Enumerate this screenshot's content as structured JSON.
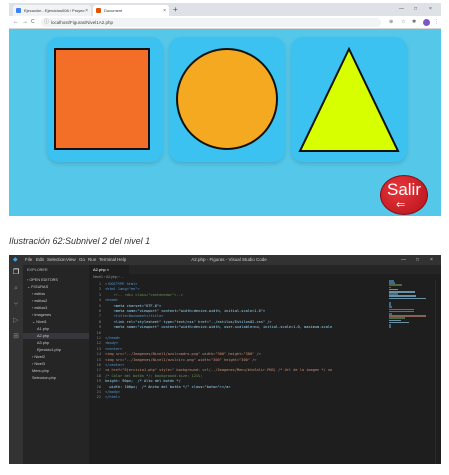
{
  "browser": {
    "tabs": [
      {
        "label": "Ejecución - Ejercicios008 / Proyec",
        "icon": "doc-icon",
        "color": "#3b82f6"
      },
      {
        "label": "Document",
        "icon": "html-icon",
        "color": "#e65100"
      }
    ],
    "new_tab_label": "+",
    "tab_close_label": "×",
    "window_controls": [
      "—",
      "□",
      "×"
    ],
    "nav": {
      "back": "←",
      "forward": "→",
      "reload": "C"
    },
    "address": "localhost/Figuras/Nivel1A2.php",
    "page_bg": "#55c8ea",
    "card_color": "#3cc2f0",
    "shapes": [
      {
        "name": "square",
        "fill": "#f36e27"
      },
      {
        "name": "circle",
        "fill": "#f5a921"
      },
      {
        "name": "triangle",
        "fill": "#d8ff00"
      }
    ],
    "salir_label": "Salir",
    "salir_arrow": "⇐"
  },
  "caption": "Ilustración 62:Subnivel 2 del nivel 1",
  "vscode": {
    "menu": [
      "File",
      "Edit",
      "Selection",
      "View",
      "Go",
      "Run",
      "Terminal",
      "Help"
    ],
    "window_title": "A2.php - Figuras - Visual Studio Code",
    "window_controls": [
      "—",
      "□",
      "×"
    ],
    "activity_icons": [
      "files-icon",
      "search-icon",
      "source-control-icon",
      "run-icon",
      "extensions-icon"
    ],
    "explorer": {
      "header": "EXPLORER",
      "sections": [
        {
          "label": "› OPEN EDITORS",
          "indent": 0
        },
        {
          "label": "⌄ FIGURAS",
          "indent": 0
        },
        {
          "label": "› estilos",
          "indent": 1
        },
        {
          "label": "› estilos2",
          "indent": 1
        },
        {
          "label": "› estilos3",
          "indent": 1
        },
        {
          "label": "› Imagenes",
          "indent": 1
        },
        {
          "label": "⌄ Nivel1",
          "indent": 1
        },
        {
          "label": "A1.php",
          "indent": 2
        },
        {
          "label": "A2.php",
          "indent": 2,
          "selected": true
        },
        {
          "label": "A3.php",
          "indent": 2
        },
        {
          "label": "Ejercicio1.php",
          "indent": 2
        },
        {
          "label": "› Nivel2",
          "indent": 1
        },
        {
          "label": "› Nivel3",
          "indent": 1
        },
        {
          "label": "Menu.php",
          "indent": 1
        },
        {
          "label": "Seleccion.php",
          "indent": 1
        }
      ]
    },
    "tab": "A2.php ×",
    "breadcrumb": "Nivel1 › A2.php › ...",
    "code_lines": [
      "<!DOCTYPE html>",
      "<html lang=\"en\">",
      "    <!-- <div class=\"contenedor\">-->",
      "<head>",
      "    <meta charset=\"UTF-8\">",
      "    <meta name=\"viewport\" content=\"width=device-width, initial-scale=1.0\">",
      "    <title>Document</title>",
      "    <link rel=\"stylesheet\" type=\"text/css\" href=\"../estilos/Estilos02.css\" />",
      "    <meta name=\"viewport\" content=\"width=device-width, user-scalable=no, initial-scale=1.0, maximum-scale",
      "",
      "</head>",
      "<body>",
      "<center>",
      "<img src=\"../Imagenes/Nivel1/azulcuadro.png\" width=\"300\" height=\"300\" />",
      "<img src=\"../Imagenes/Nivel1/azulcirc.png\" width=\"300\" height=\"300\" />",
      "</center>",
      "<a href=\"Ejercicio1.php\" style=\" background: url(../Imagenes/Menu/btnSalir.PNG) /* Url de la imagen */ no",
      "/* Color del botón */; background-size: 121%;",
      "height: 90px;  /* Alto del botón */",
      "  width: 100px;  /* Ancho del botón */\" class=\"boton\"></a>",
      "</body>",
      "</html>"
    ]
  }
}
